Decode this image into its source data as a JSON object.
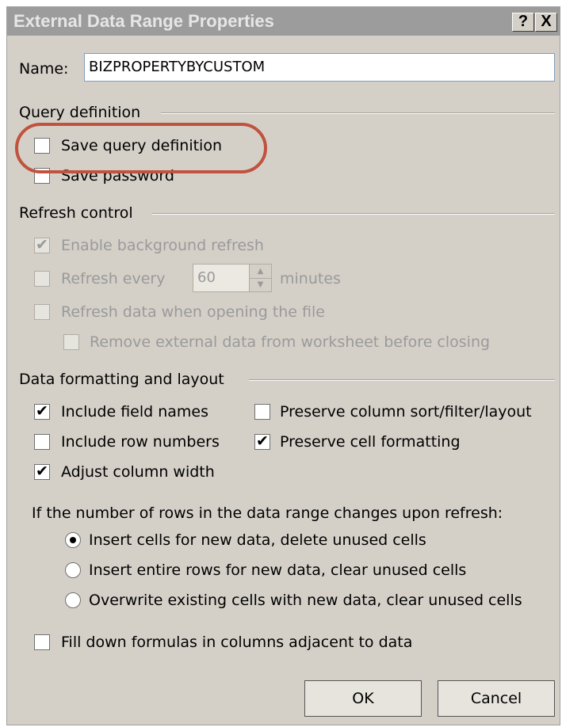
{
  "window": {
    "title": "External Data Range Properties",
    "help_button": "?",
    "close_button": "X"
  },
  "name_field": {
    "label": "Name:",
    "value": "BIZPROPERTYBYCUSTOM"
  },
  "query_definition": {
    "group_label": "Query definition",
    "save_query_definition": {
      "label": "Save query definition",
      "checked": false
    },
    "save_password": {
      "label": "Save password",
      "checked": false
    }
  },
  "refresh_control": {
    "group_label": "Refresh control",
    "enable_background_refresh": {
      "label": "Enable background refresh",
      "checked": true,
      "enabled": false
    },
    "refresh_every": {
      "label": "Refresh every",
      "value": "60",
      "unit": "minutes",
      "checked": false,
      "enabled": false
    },
    "refresh_on_open": {
      "label": "Refresh data when opening the file",
      "checked": false,
      "enabled": false
    },
    "remove_external_data": {
      "label": "Remove external data from worksheet before closing",
      "checked": false,
      "enabled": false
    }
  },
  "data_formatting": {
    "group_label": "Data formatting and layout",
    "include_field_names": {
      "label": "Include field names",
      "checked": true
    },
    "include_row_numbers": {
      "label": "Include row numbers",
      "checked": false
    },
    "adjust_column_width": {
      "label": "Adjust column width",
      "checked": true
    },
    "preserve_column_sort": {
      "label": "Preserve column sort/filter/layout",
      "checked": false
    },
    "preserve_cell_formatting": {
      "label": "Preserve cell formatting",
      "checked": true
    },
    "rows_change_prompt": "If the number of rows in the data range changes upon refresh:",
    "options": [
      {
        "label": "Insert cells for new data, delete unused cells",
        "selected": true
      },
      {
        "label": "Insert entire rows for new data, clear unused cells",
        "selected": false
      },
      {
        "label": "Overwrite existing cells with new data, clear unused cells",
        "selected": false
      }
    ],
    "fill_down_formulas": {
      "label": "Fill down formulas in columns adjacent to data",
      "checked": false
    }
  },
  "buttons": {
    "ok": "OK",
    "cancel": "Cancel"
  },
  "colors": {
    "annotation_outline": "#c0523e",
    "dialog_face": "#d4d0c8",
    "titlebar": "#9c9c9c"
  },
  "check_glyph": "✔"
}
